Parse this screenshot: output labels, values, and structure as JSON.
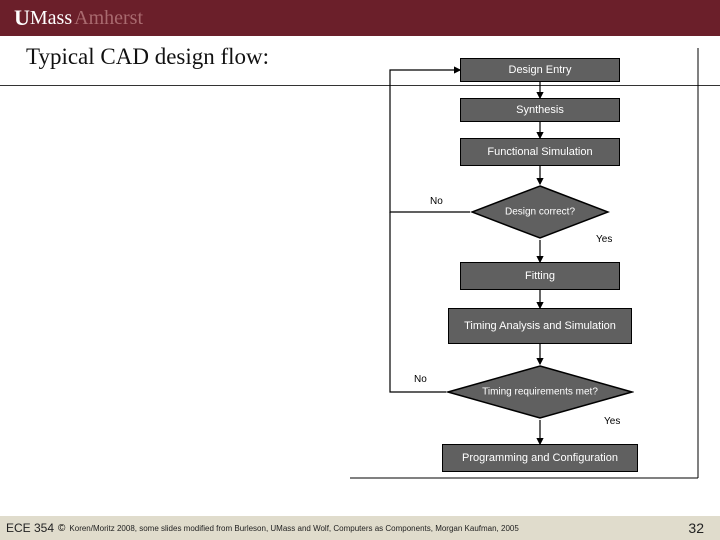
{
  "header": {
    "logo_u": "U",
    "logo_mass": "Mass",
    "logo_amherst": "Amherst"
  },
  "title": "Typical CAD design flow:",
  "flow": {
    "boxes": {
      "design_entry": "Design Entry",
      "synthesis": "Synthesis",
      "functional_sim": "Functional Simulation",
      "design_correct": "Design correct?",
      "fitting": "Fitting",
      "timing_analysis": "Timing Analysis and Simulation",
      "timing_met": "Timing requirements met?",
      "programming": "Programming and Configuration"
    },
    "labels": {
      "no1": "No",
      "yes1": "Yes",
      "no2": "No",
      "yes2": "Yes"
    }
  },
  "footer": {
    "course": "ECE 354",
    "copyright_symbol": "©",
    "credits": "Koren/Moritz 2008,  some slides modified from Burleson, UMass and Wolf, Computers as Components, Morgan Kaufman, 2005",
    "page": "32"
  }
}
